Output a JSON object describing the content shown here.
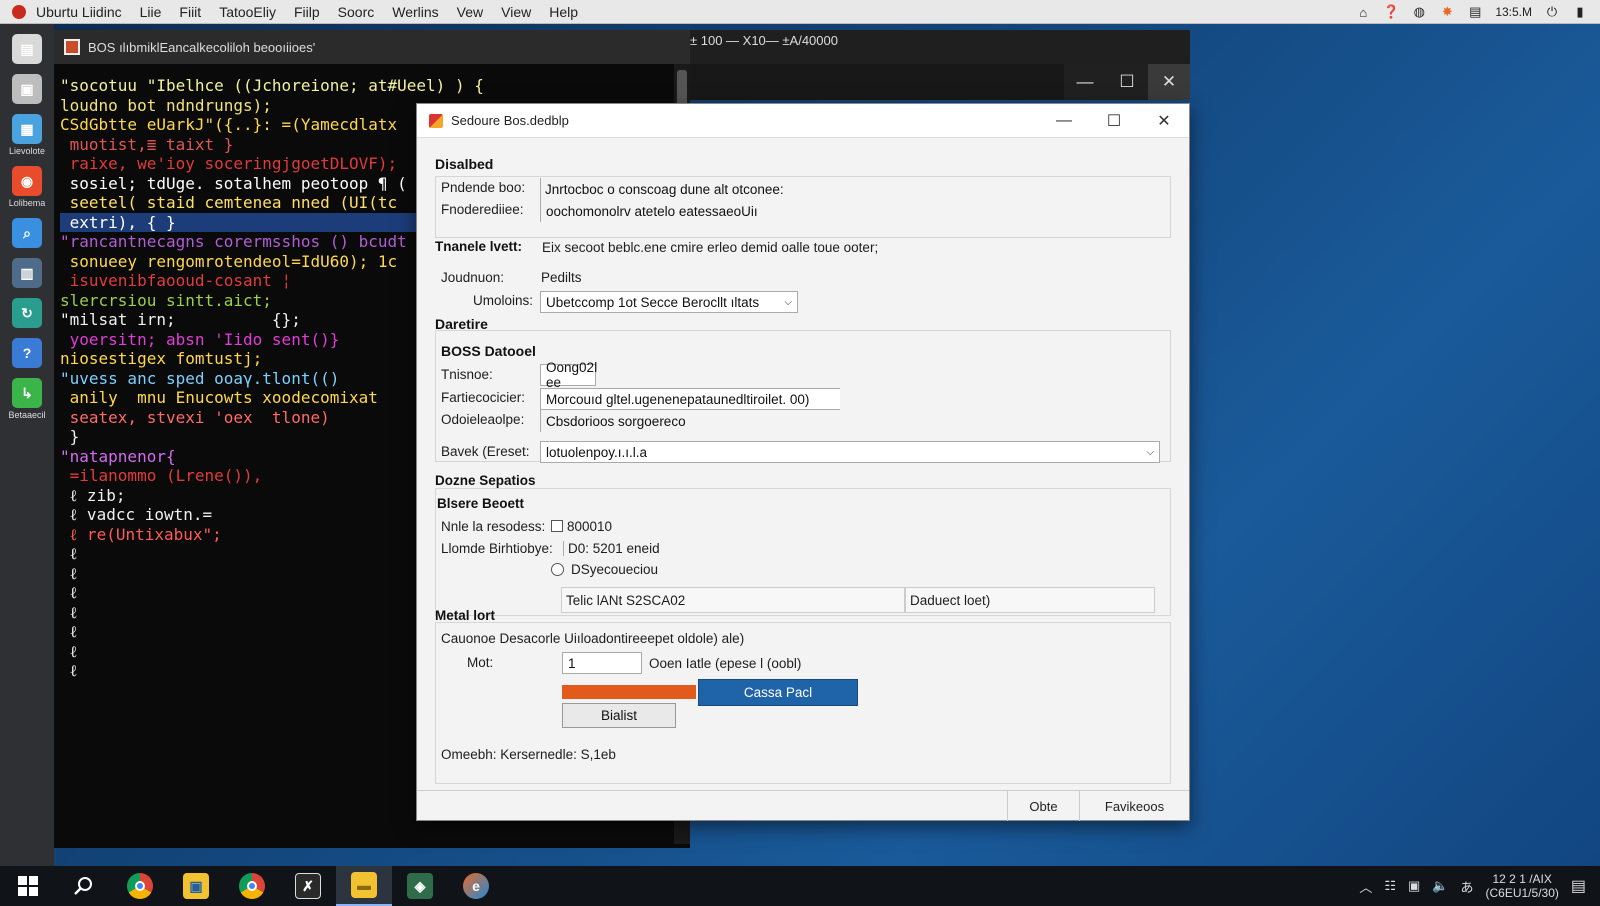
{
  "menubar": {
    "app": "Uburtu Liidinc",
    "items": [
      "Liie",
      "Fiiit",
      "TatooEliy",
      "Fiilp",
      "Soorc",
      "Werlins",
      "Vew",
      "View",
      "Help"
    ],
    "clock": "13:5.M"
  },
  "dock": {
    "items": [
      {
        "label": "",
        "icon": "document-icon",
        "color": "#d9d9d9"
      },
      {
        "label": "",
        "icon": "terminal-icon",
        "color": "#bdbdbd"
      },
      {
        "label": "Lievolote",
        "icon": "image-viewer-icon",
        "color": "#4aa3df"
      },
      {
        "label": "Lolibema",
        "icon": "browser-icon",
        "color": "#e94c2d"
      },
      {
        "label": "",
        "icon": "search-tool-icon",
        "color": "#3a8fe0"
      },
      {
        "label": "",
        "icon": "calendar-icon",
        "color": "#4f6b8a"
      },
      {
        "label": "",
        "icon": "sync-icon",
        "color": "#2a9d8f"
      },
      {
        "label": "",
        "icon": "help-icon",
        "color": "#3a7bd5"
      },
      {
        "label": "Betaaecil",
        "icon": "app-icon",
        "color": "#3bb54a"
      }
    ]
  },
  "terminal": {
    "title": "BOS ılıbmiklEancalkecoliloh beooıiioes'",
    "lines": [
      {
        "text": "\"socotuu \"Ibelhce ((Jchoreione; at#Ueel) ) {",
        "color": "#f2f29a"
      },
      {
        "text": "loudno bot ndndrungs);",
        "color": "#f2e27a"
      },
      {
        "text": "CSdGbtte eUarkJ\"({..}: =(Yamecdlatx",
        "color": "#ffd84a"
      },
      {
        "text": " muotist,≣ taixt }",
        "color": "#e25555"
      },
      {
        "text": " raixe, we'ioy soceringjgoetDLOVF);",
        "color": "#e03a3a"
      },
      {
        "text": " sosiel; tdUge. sotalhem peotoop ¶ (",
        "color": "#ffffff"
      },
      {
        "text": " seetel( staid cemtenea nned (UI(tc",
        "color": "#ffe066"
      },
      {
        "text": " extri), { }",
        "color": "#ffffff",
        "highlight": true
      },
      {
        "text": "\"rancantnecagns corermsshos () bcudt",
        "color": "#b25cd6"
      },
      {
        "text": " sonueey rengomrotendeol=IdU60); 1c",
        "color": "#ffd84a"
      },
      {
        "text": " isuvenibfaooud-cosant ¦",
        "color": "#e23b3b"
      },
      {
        "text": "slercrsiou sintt.aict;",
        "color": "#9ad04a"
      },
      {
        "text": "\"milsat irn;          {};",
        "color": "#f0f0f0"
      },
      {
        "text": " yoersitn; absn 'Iido sent()}",
        "color": "#e23bd8"
      },
      {
        "text": "niosestigex fomtustj;",
        "color": "#ffd84a"
      },
      {
        "text": "\"uvess anc sped ooaγ.tlont(()",
        "color": "#7ad0ff"
      },
      {
        "text": " anily  mnu Enucowts xoodecomixat",
        "color": "#ffd84a"
      },
      {
        "text": " seatex, stvexi 'oex  tlone)",
        "color": "#ff6a6a"
      },
      {
        "text": " }",
        "color": "#f0f0f0"
      },
      {
        "text": "\"natapnenor{",
        "color": "#d46af0"
      },
      {
        "text": " =ilanommo (Lrene()),",
        "color": "#e23b3b"
      },
      {
        "text": " ℓ zib;",
        "color": "#f0f0f0"
      },
      {
        "text": " ℓ vadcc iowtn.=",
        "color": "#f0f0f0"
      },
      {
        "text": " ℓ re(Untixabux\";",
        "color": "#ff5a5a"
      },
      {
        "text": " ℓ",
        "color": "#f0f0f0"
      },
      {
        "text": " ℓ",
        "color": "#f0f0f0"
      },
      {
        "text": " ℓ",
        "color": "#f0f0f0"
      },
      {
        "text": " ℓ",
        "color": "#f0f0f0"
      },
      {
        "text": " ℓ",
        "color": "#f0f0f0"
      },
      {
        "text": " ℓ",
        "color": "#f0f0f0"
      },
      {
        "text": " ℓ",
        "color": "#f0f0f0"
      }
    ]
  },
  "bgwindow": {
    "title": "± 100 —     X10—  ±A/40000"
  },
  "dialog": {
    "title": "Sedoure Bos.dedblp",
    "sections": {
      "disabled": {
        "head": "Disalbed",
        "rows": [
          {
            "label": "Pndende boo:",
            "value": "Jnrtocboc o conscoag dune alt otconee:"
          },
          {
            "label": "Fnoderediiee:",
            "value": "oochomonolrv atetelo eatessaeoUiı"
          }
        ]
      },
      "tranale": {
        "label": "Tnanele lvett:",
        "text": "Eix secoot beblc.ene cmire erleo demid oalle toue ooter;",
        "row1_label": "Joudnuon:",
        "row1_value": "Pedilts",
        "row2_label": "Umoloins:",
        "row2_value": "Ubetccomp 1ot Secce Berocllt ıltats"
      },
      "datetire": {
        "head": "Daretire",
        "sub": "BOSS Datooel",
        "rows": [
          {
            "label": "Tnisnoe:",
            "value": "Oong02ǀ ee"
          },
          {
            "label": "Fartiecocicier:",
            "value": "Morcouıd gltel.ugenenepataunedltiroilet. 00)"
          },
          {
            "label": "Odoieleaolpe:",
            "value": "Cbsdorioos sorgoereco"
          }
        ],
        "select_label": "Bavek (Ereset:",
        "select_value": "lotuolenpoy.ı.ı.l.a"
      },
      "dozne": {
        "head": "Dozne Sepatios",
        "sub": "Blsere Beoett",
        "check_label": "Nnle la resodess:",
        "check_value": "800010",
        "row_label": "Llomde Birhtiobye:",
        "row_value": "D0: 5201 eneid",
        "radio_label": "DSyecoueciou",
        "col1": "Telic lANt S2SCA02",
        "col2": "Daduect loet)"
      },
      "metal": {
        "head": "Metal lort",
        "desc": "Cauonoe Desacorle Uiıloadontireeepet oldole) ale)",
        "mot_label": "Mot:",
        "mot_value": "1",
        "mot_hint": "Ooen Iatle (epese l (oobl)",
        "primary_btn": "Cassa Pacl",
        "secondary_btn": "Bialist",
        "progress": 1.0,
        "footer_text": "Omeebh: Kersernedle: S,1eb"
      }
    },
    "footer": {
      "btn1": "Obte",
      "btn2": "Favikeoos"
    }
  },
  "taskbar": {
    "clock_time": "12 2 1 /AIX",
    "clock_date": "(C6EU1/5/30)"
  }
}
